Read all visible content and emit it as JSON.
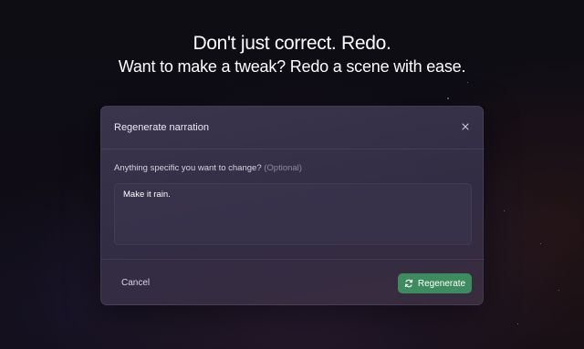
{
  "hero": {
    "headline": "Don't just correct. Redo.",
    "subheadline": "Want to make a tweak? Redo a scene with ease."
  },
  "modal": {
    "title": "Regenerate narration",
    "close_icon": "close-icon",
    "field": {
      "label": "Anything specific you want to change?",
      "optional_hint": "(Optional)",
      "value": "Make it rain."
    },
    "footer": {
      "cancel_label": "Cancel",
      "regenerate_label": "Regenerate",
      "regenerate_icon": "refresh-icon"
    }
  },
  "colors": {
    "accent_green": "#3d8c5f",
    "modal_background": "#3a3450",
    "page_background": "#0e0d14"
  }
}
